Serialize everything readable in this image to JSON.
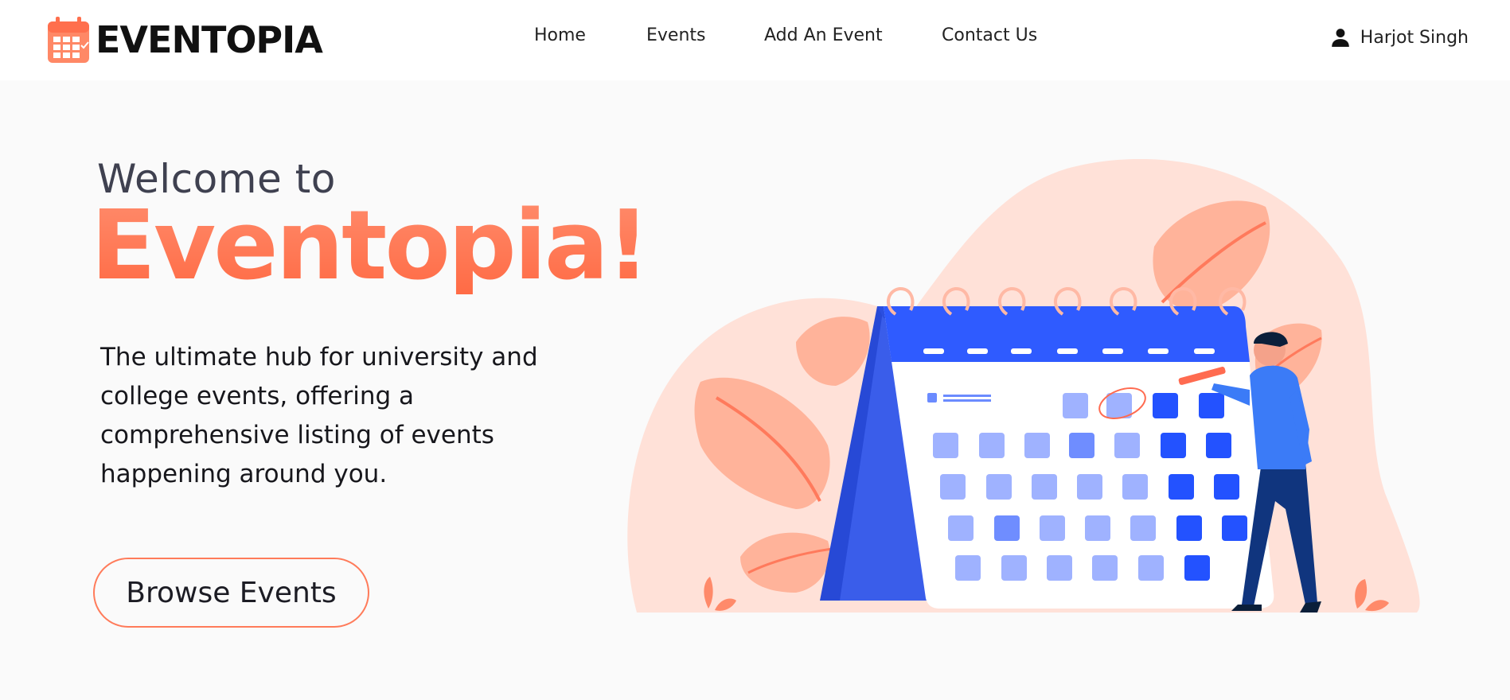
{
  "brand": {
    "logo_text": "EVENTOPIA"
  },
  "nav": {
    "items": [
      {
        "label": "Home"
      },
      {
        "label": "Events"
      },
      {
        "label": "Add An Event"
      },
      {
        "label": "Contact Us"
      }
    ]
  },
  "user": {
    "name": "Harjot Singh",
    "icon": "user-icon"
  },
  "hero": {
    "welcome": "Welcome to",
    "title": "Eventopia!",
    "tagline": "The ultimate hub for university and college events, offering a comprehensive listing of events happening around you.",
    "cta_label": "Browse Events"
  },
  "colors": {
    "accent": "#ff7452",
    "calendar_blue": "#2f5bff",
    "background": "#fafafa",
    "blob": "#ffe1d8"
  }
}
